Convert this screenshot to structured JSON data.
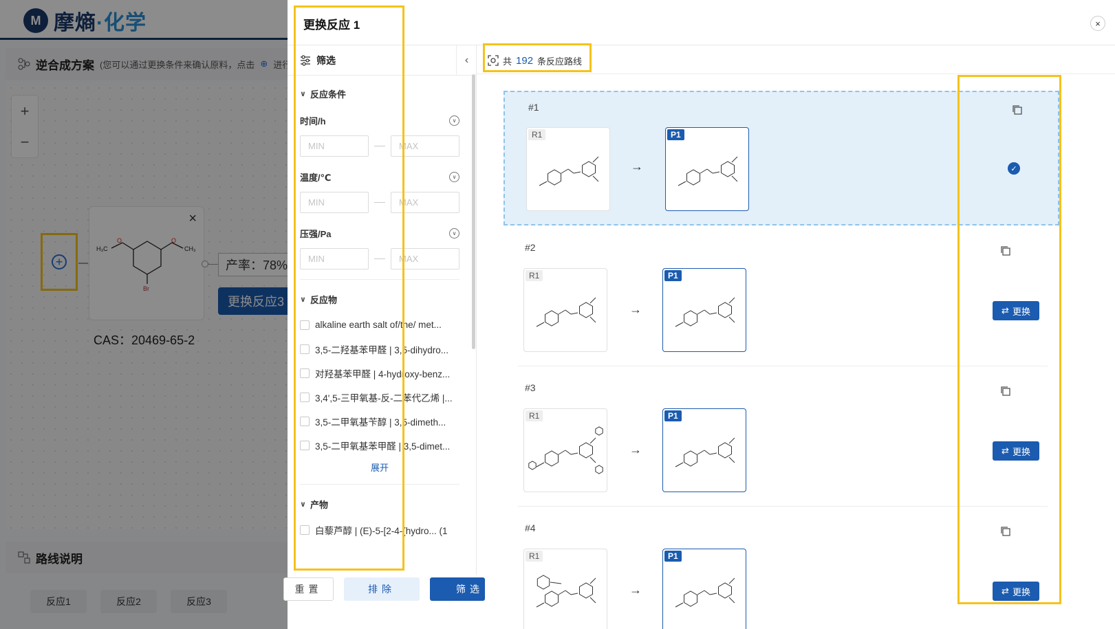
{
  "app": {
    "logo_mark": "M",
    "logo_text_a": "摩熵",
    "logo_text_b": "·化学"
  },
  "background": {
    "section_title": "逆合成方案",
    "section_hint": "(您可以通过更换条件来确认原料，点击",
    "section_hint_tail": "进行下一",
    "zoom_in": "+",
    "zoom_out": "−",
    "cas_label": "CAS：20469-65-2",
    "yield_label": "产率：78%",
    "replace_btn": "更换反应3",
    "route_title": "路线说明",
    "tabs": [
      "反应1",
      "反应2",
      "反应3"
    ]
  },
  "drawer": {
    "title": "更换反应 1",
    "close": "×",
    "filter": {
      "title": "筛选",
      "collapse": "‹",
      "group_conditions": "反应条件",
      "fields": [
        {
          "label": "时间/h",
          "min_placeholder": "MIN",
          "max_placeholder": "MAX"
        },
        {
          "label": "温度/℃",
          "min_placeholder": "MIN",
          "max_placeholder": "MAX"
        },
        {
          "label": "压强/Pa",
          "min_placeholder": "MIN",
          "max_placeholder": "MAX"
        }
      ],
      "group_reactants": "反应物",
      "reactants": [
        "alkaline earth salt of/the/ met...",
        "3,5-二羟基苯甲醛 | 3,5-dihydro...",
        "对羟基苯甲醛 | 4-hydroxy-benz...",
        "3,4',5-三甲氧基-反-二苯代乙烯 |...",
        "3,5-二甲氧基苄醇 | 3,5-dimeth...",
        "3,5-二甲氧基苯甲醛 | 3,5-dimet..."
      ],
      "expand": "展开",
      "group_products": "产物",
      "products": [
        "白藜芦醇 | (E)-5-[2-4-(hydro...  (1"
      ],
      "reset": "重置",
      "exclude": "排除",
      "apply": "筛选"
    },
    "results": {
      "count_prefix": "共",
      "count": "192",
      "count_suffix": "条反应路线",
      "routes": [
        {
          "id": "#1",
          "reactant_tag": "R1",
          "product_tag": "P1",
          "arrow": "→",
          "selected": true
        },
        {
          "id": "#2",
          "reactant_tag": "R1",
          "product_tag": "P1",
          "arrow": "→",
          "action": "更换"
        },
        {
          "id": "#3",
          "reactant_tag": "R1",
          "product_tag": "P1",
          "arrow": "→",
          "action": "更换"
        },
        {
          "id": "#4",
          "reactant_tag": "R1",
          "product_tag": "P1",
          "arrow": "→",
          "action": "更换"
        }
      ]
    }
  },
  "colors": {
    "brand": "#1b3a6b",
    "primary": "#1b5bb0",
    "highlight": "#f5c21b",
    "selected_bg": "#e3f0fa"
  }
}
